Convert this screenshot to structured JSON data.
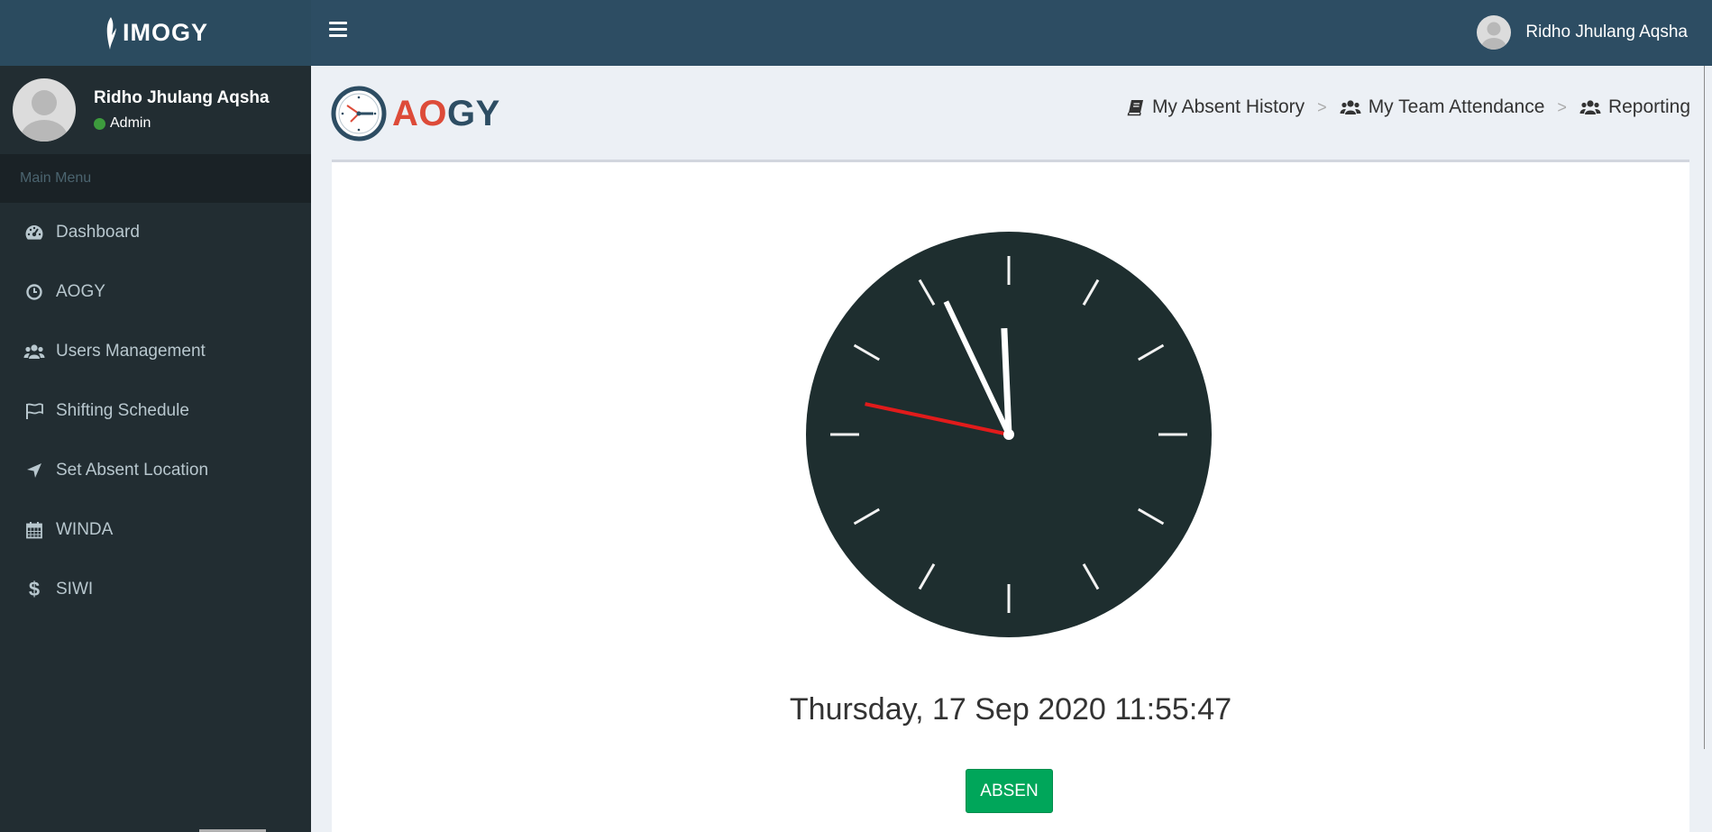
{
  "app": {
    "brand": "IMOGY"
  },
  "topbar": {
    "user_name": "Ridho Jhulang Aqsha"
  },
  "sidebar": {
    "user_name": "Ridho Jhulang Aqsha",
    "user_role": "Admin",
    "section_header": "Main Menu",
    "items": [
      {
        "label": "Dashboard",
        "icon": "dashboard-icon"
      },
      {
        "label": "AOGY",
        "icon": "clock-icon"
      },
      {
        "label": "Users Management",
        "icon": "users-icon"
      },
      {
        "label": "Shifting Schedule",
        "icon": "flag-icon"
      },
      {
        "label": "Set Absent Location",
        "icon": "location-arrow-icon"
      },
      {
        "label": "WINDA",
        "icon": "calendar-icon"
      },
      {
        "label": "SIWI",
        "icon": "dollar-icon"
      }
    ]
  },
  "header": {
    "logo_text_a": "AO",
    "logo_text_b": "GY",
    "breadcrumbs": [
      {
        "label": "My Absent History",
        "icon": "book-icon"
      },
      {
        "label": "My Team Attendance",
        "icon": "users-icon"
      },
      {
        "label": "Reporting",
        "icon": "users-icon"
      }
    ],
    "separator": ">"
  },
  "main": {
    "datetime": "Thursday, 17 Sep 2020 11:55:47",
    "button_label": "ABSEN",
    "clock": {
      "hour": 11,
      "minute": 55,
      "second": 47
    }
  },
  "colors": {
    "sidebar_bg": "#222d32",
    "topbar_bg": "#2d4d63",
    "clock_face": "#1e2e2f",
    "second_hand": "#e11b1b",
    "button_green": "#00a65a",
    "logo_red": "#dd4b39"
  }
}
